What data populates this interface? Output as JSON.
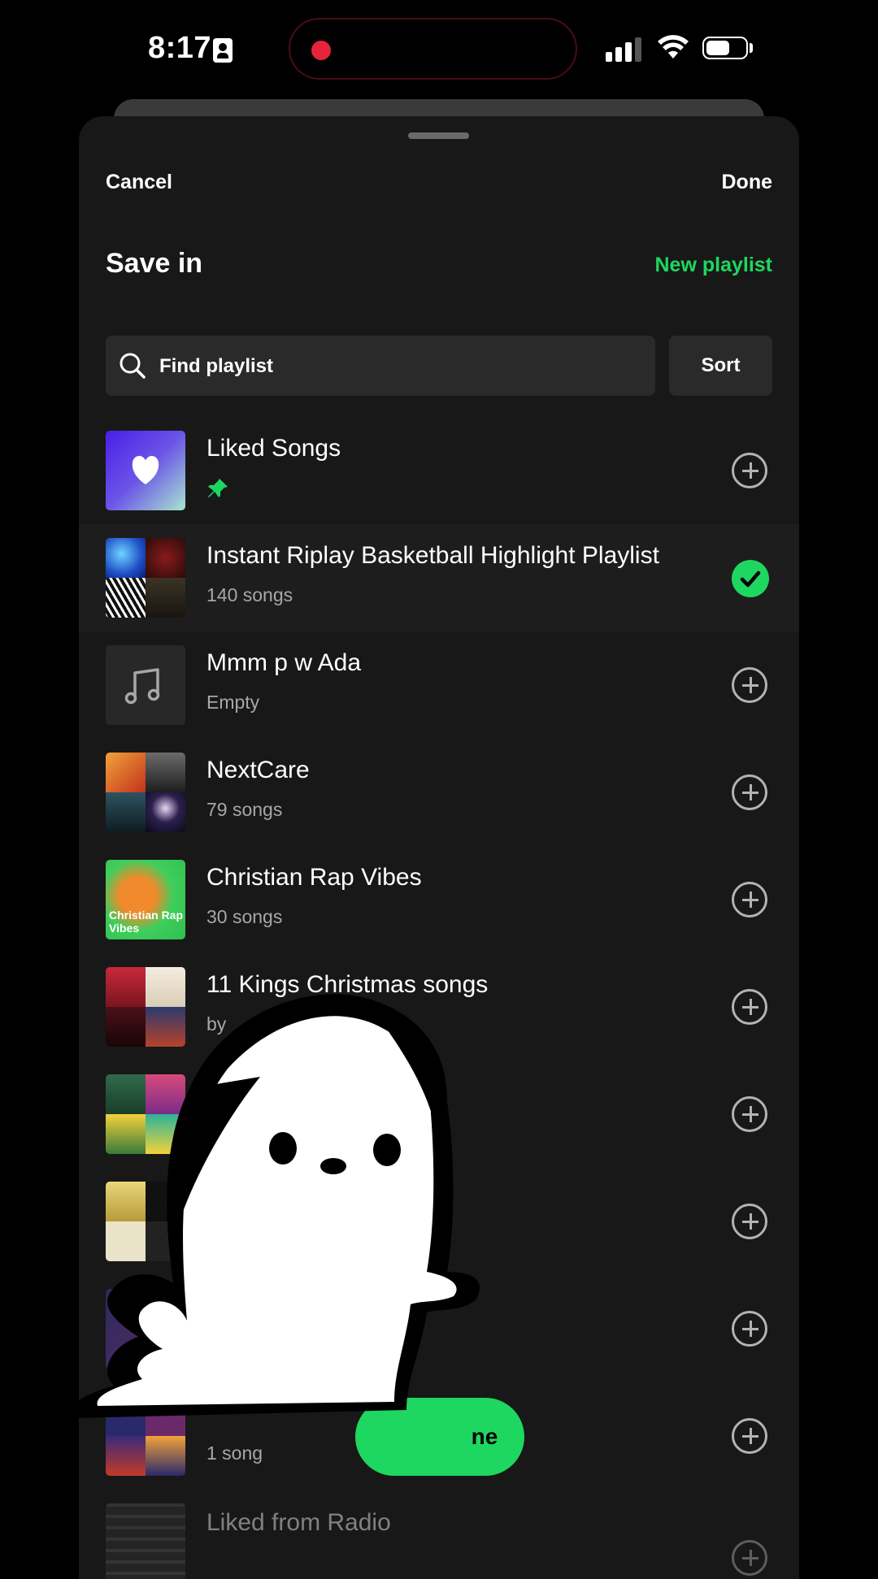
{
  "status_bar": {
    "time": "8:17"
  },
  "header": {
    "cancel_label": "Cancel",
    "done_label": "Done",
    "title": "Save in",
    "new_playlist_label": "New playlist"
  },
  "search": {
    "placeholder": "Find playlist",
    "sort_label": "Sort"
  },
  "playlists": [
    {
      "title": "Liked Songs",
      "subtitle": "",
      "pinned": true,
      "added": false
    },
    {
      "title": "Instant Riplay Basketball Highlight Playlist",
      "subtitle": "140 songs",
      "added": true
    },
    {
      "title": "Mmm p w Ada",
      "subtitle": "Empty",
      "added": false
    },
    {
      "title": "NextCare",
      "subtitle": "79 songs",
      "added": false
    },
    {
      "title": "Christian Rap Vibes",
      "subtitle": "30 songs",
      "thumb_text": "Christian Rap Vibes",
      "added": false
    },
    {
      "title": "11 Kings Christmas songs",
      "subtitle": "by",
      "added": false
    },
    {
      "title": "",
      "subtitle": "",
      "added": false
    },
    {
      "title": "",
      "subtitle": "",
      "added": false
    },
    {
      "title": "",
      "subtitle": "",
      "added": false
    },
    {
      "title": "",
      "subtitle": "1 song",
      "added": false
    },
    {
      "title": "Liked from Radio",
      "subtitle": "",
      "added": false
    }
  ],
  "done_button_label": "ne",
  "colors": {
    "accent": "#1ed760",
    "sheet": "#181818",
    "record": "#e5243a"
  }
}
